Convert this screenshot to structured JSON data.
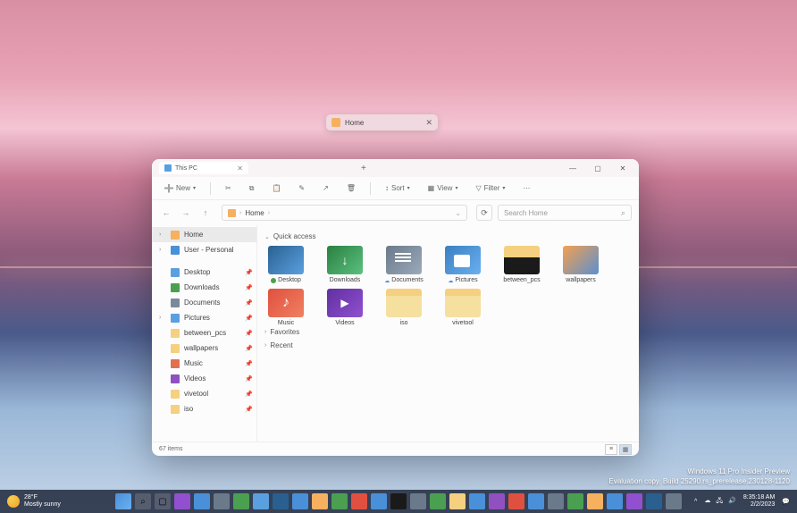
{
  "floating_tab": {
    "label": "Home"
  },
  "explorer": {
    "tab_title": "This PC",
    "toolbar": {
      "new": "New",
      "sort": "Sort",
      "view": "View",
      "filter": "Filter"
    },
    "address": {
      "segment": "Home"
    },
    "search_placeholder": "Search Home",
    "sidebar": {
      "home": "Home",
      "user": "User - Personal",
      "desktop": "Desktop",
      "downloads": "Downloads",
      "documents": "Documents",
      "pictures": "Pictures",
      "between_pcs": "between_pcs",
      "wallpapers": "wallpapers",
      "music": "Music",
      "videos": "Videos",
      "vivetool": "vivetool",
      "iso": "iso"
    },
    "sections": {
      "quick_access": "Quick access",
      "favorites": "Favorites",
      "recent": "Recent"
    },
    "items": {
      "desktop": "Desktop",
      "downloads": "Downloads",
      "documents": "Documents",
      "pictures": "Pictures",
      "between_pcs": "between_pcs",
      "wallpapers": "wallpapers",
      "music": "Music",
      "videos": "Videos",
      "iso": "iso",
      "vivetool": "vivetool"
    },
    "status": "67 items"
  },
  "build": {
    "line1": "Windows 11 Pro Insider Preview",
    "line2": "Evaluation copy. Build 25290.rs_prerelease.230128-1120"
  },
  "taskbar": {
    "weather_temp": "28°F",
    "weather_cond": "Mostly sunny",
    "time": "8:35:18 AM",
    "date": "2/2/2023"
  }
}
